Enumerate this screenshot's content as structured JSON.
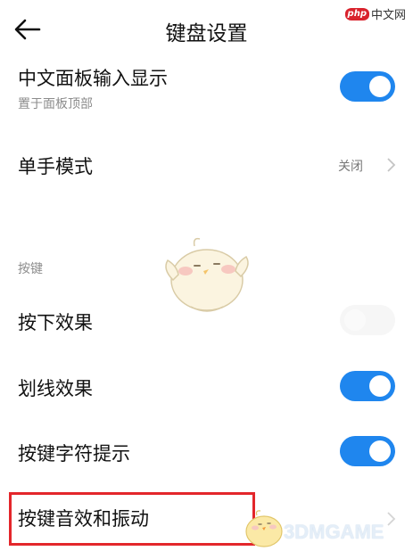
{
  "header": {
    "title": "键盘设置",
    "back_icon": "arrow-left-icon"
  },
  "watermark_top": {
    "badge": "php",
    "text": "中文网"
  },
  "settings": {
    "chinese_panel": {
      "label": "中文面板输入显示",
      "sub": "置于面板顶部",
      "enabled": true
    },
    "one_hand": {
      "label": "单手模式",
      "value": "关闭",
      "chevron_icon": "chevron-right-icon"
    },
    "section_keys": "按键",
    "press_effect": {
      "label": "按下效果",
      "enabled": false
    },
    "swipe_effect": {
      "label": "划线效果",
      "enabled": true
    },
    "key_hint": {
      "label": "按键字符提示",
      "enabled": true
    },
    "sound_vibration": {
      "label": "按键音效和振动",
      "chevron_icon": "chevron-right-icon"
    }
  },
  "watermark_bottom": {
    "text": "3DMGAME"
  },
  "colors": {
    "toggle_on": "#1f86ee",
    "highlight_border": "#e3262b"
  }
}
